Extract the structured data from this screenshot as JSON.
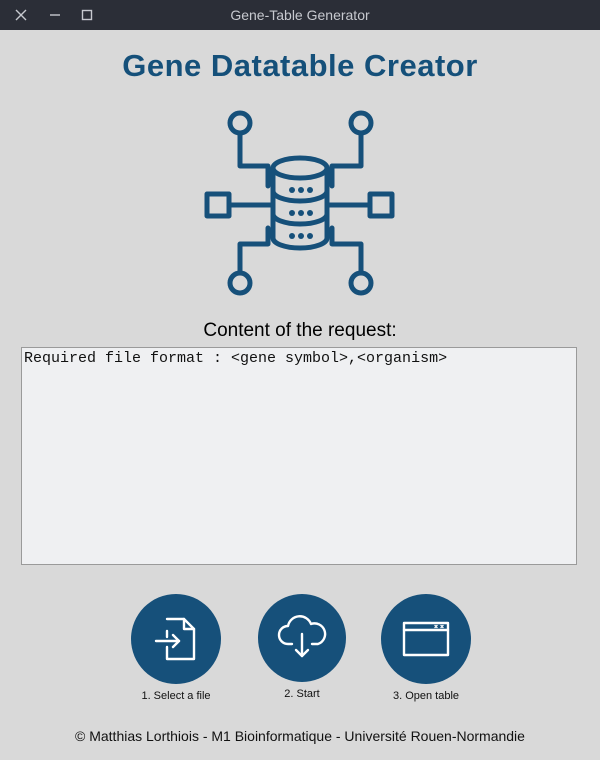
{
  "window": {
    "title": "Gene-Table Generator",
    "controls": [
      "close-icon",
      "minimize-icon",
      "maximize-icon"
    ]
  },
  "header": {
    "title": "Gene Datatable Creator",
    "logo_icon": "database-network-icon"
  },
  "request": {
    "label": "Content of the request:",
    "text": "Required file format : <gene symbol>,<organism>"
  },
  "actions": [
    {
      "label": "1. Select a file",
      "icon": "file-import-icon"
    },
    {
      "label": "2. Start",
      "icon": "cloud-download-icon"
    },
    {
      "label": "3. Open table",
      "icon": "window-icon"
    }
  ],
  "footer": {
    "text": "© Matthias Lorthiois - M1 Bioinformatique - Université Rouen-Normandie"
  },
  "colors": {
    "titlebar": "#2b2e37",
    "accent": "#15507a",
    "background": "#d9d9d9",
    "textarea_bg": "#eff0f2"
  }
}
